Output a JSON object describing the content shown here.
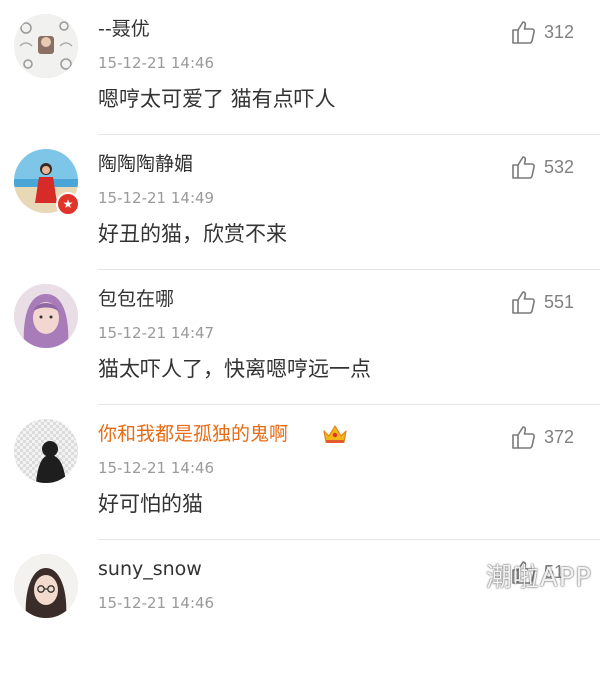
{
  "colors": {
    "username": "#333333",
    "vip_username": "#e86b16",
    "timestamp": "#9a9a9a",
    "text": "#333333",
    "like": "#808080",
    "divider": "#e6e6e6"
  },
  "comments": [
    {
      "username": "--聂优",
      "timestamp": "15-12-21 14:46",
      "text": "嗯哼太可爱了 猫有点吓人",
      "likes": "312",
      "avatar_icon": "cartoon-pattern-avatar"
    },
    {
      "username": "陶陶陶静媚",
      "timestamp": "15-12-21 14:49",
      "text": "好丑的猫，欣赏不来",
      "likes": "532",
      "avatar_icon": "red-dress-beach-avatar",
      "verified": true
    },
    {
      "username": "包包在哪",
      "timestamp": "15-12-21 14:47",
      "text": "猫太吓人了，快离嗯哼远一点",
      "likes": "551",
      "avatar_icon": "purple-hair-girl-avatar"
    },
    {
      "username": "你和我都是孤独的鬼啊",
      "timestamp": "15-12-21 14:46",
      "text": "好可怕的猫",
      "likes": "372",
      "avatar_icon": "dark-silhouette-avatar",
      "vip": true
    },
    {
      "username": "suny_snow",
      "timestamp": "15-12-21 14:46",
      "text": "",
      "likes": "51",
      "avatar_icon": "glasses-girl-avatar"
    }
  ],
  "watermark": "潮啦APP"
}
